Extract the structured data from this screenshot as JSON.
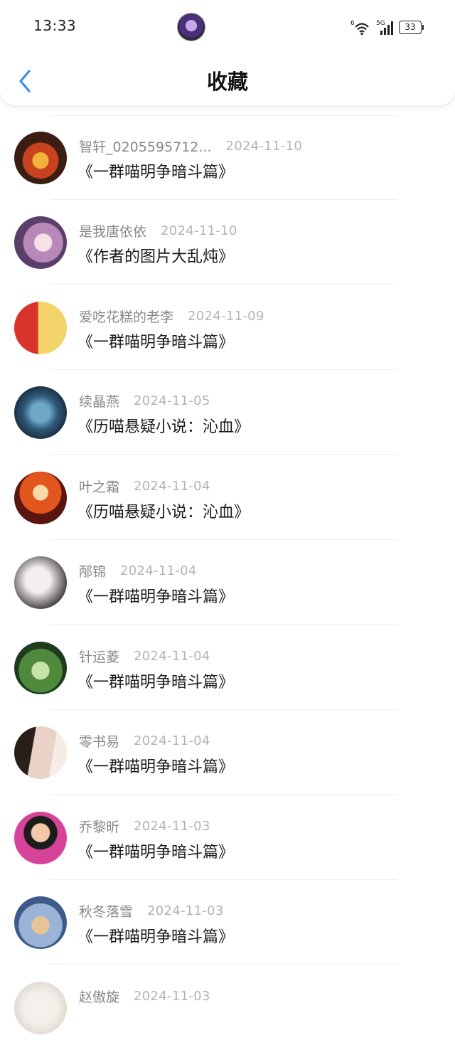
{
  "status_bar": {
    "time": "13:33",
    "network_small": "6",
    "network_label": "5G",
    "battery": "33"
  },
  "header": {
    "title": "收藏",
    "back_icon": "chevron-left-icon"
  },
  "colors": {
    "accent": "#3a8ee6",
    "name_text": "#888888",
    "date_text": "#b3b3b3",
    "title_text": "#1a1a1a"
  },
  "items": [
    {
      "name": "智轩_0205595712...",
      "date": "2024-11-10",
      "title": "《一群喵明争暗斗篇》"
    },
    {
      "name": "是我唐依依",
      "date": "2024-11-10",
      "title": "《作者的图片大乱炖》"
    },
    {
      "name": "爱吃花糕的老李",
      "date": "2024-11-09",
      "title": "《一群喵明争暗斗篇》"
    },
    {
      "name": "续晶燕",
      "date": "2024-11-05",
      "title": "《历喵悬疑小说：沁血》"
    },
    {
      "name": "叶之霜",
      "date": "2024-11-04",
      "title": "《历喵悬疑小说：沁血》"
    },
    {
      "name": "邴锦",
      "date": "2024-11-04",
      "title": "《一群喵明争暗斗篇》"
    },
    {
      "name": "针运菱",
      "date": "2024-11-04",
      "title": "《一群喵明争暗斗篇》"
    },
    {
      "name": "零书易",
      "date": "2024-11-04",
      "title": "《一群喵明争暗斗篇》"
    },
    {
      "name": "乔黎昕",
      "date": "2024-11-03",
      "title": "《一群喵明争暗斗篇》"
    },
    {
      "name": "秋冬落雪",
      "date": "2024-11-03",
      "title": "《一群喵明争暗斗篇》"
    },
    {
      "name": "赵傲旋",
      "date": "2024-11-03",
      "title": ""
    }
  ]
}
